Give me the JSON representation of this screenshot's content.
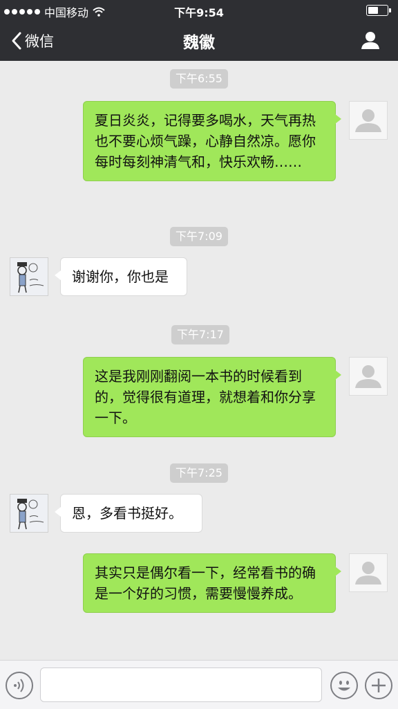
{
  "status_bar": {
    "carrier": "中国移动",
    "time": "下午9:54"
  },
  "nav": {
    "back_label": "微信",
    "title": "魏徽"
  },
  "messages": [
    {
      "timestamp": "下午6:55",
      "direction": "out",
      "text": "夏日炎炎，记得要多喝水，天气再热也不要心烦气躁，心静自然凉。愿你每时每刻神清气和，快乐欢畅……"
    },
    {
      "timestamp": "下午7:09",
      "direction": "in",
      "text": "谢谢你，你也是"
    },
    {
      "timestamp": "下午7:17",
      "direction": "out",
      "text": "这是我刚刚翻阅一本书的时候看到的，觉得很有道理，就想着和你分享一下。"
    },
    {
      "timestamp": "下午7:25",
      "direction": "in",
      "text": "恩，多看书挺好。"
    },
    {
      "direction": "out",
      "text": "其实只是偶尔看一下，经常看书的确是一个好的习惯，需要慢慢养成。"
    }
  ],
  "input": {
    "value": ""
  },
  "colors": {
    "bar": "#2e2f33",
    "bubble_out": "#a0e75a",
    "bubble_in": "#ffffff",
    "chat_bg": "#ebebeb"
  },
  "icons": [
    "signal-dots-icon",
    "wifi-icon",
    "battery-icon",
    "back-chevron-icon",
    "profile-icon",
    "voice-icon",
    "emoji-icon",
    "plus-icon"
  ]
}
